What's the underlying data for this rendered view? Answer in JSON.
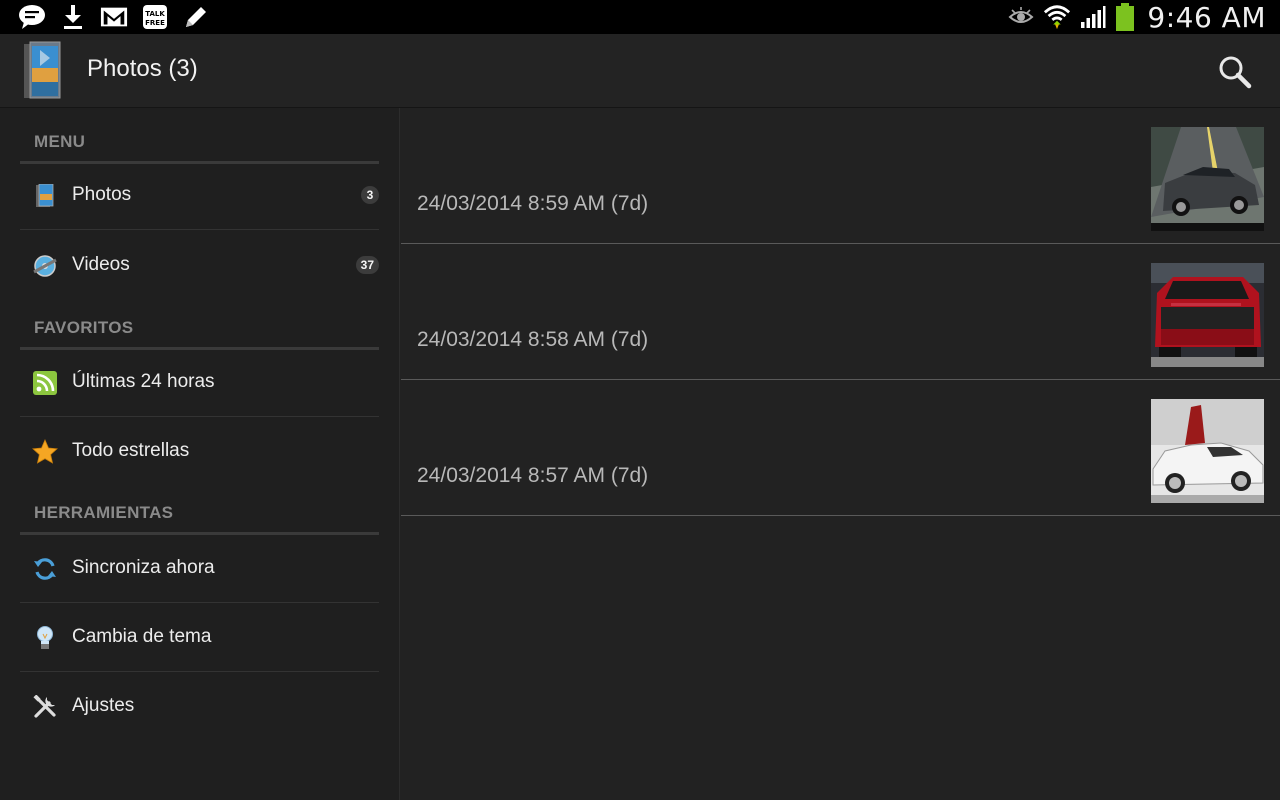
{
  "status_bar": {
    "icons": [
      "chat-icon",
      "download-icon",
      "gmail-icon",
      "talk-free-icon",
      "edit-icon"
    ],
    "right_icons": [
      "eye-icon",
      "wifi-icon",
      "signal-icon",
      "battery-icon"
    ],
    "talk_free_text": "TALK FREE",
    "time": "9:46 AM"
  },
  "action_bar": {
    "title": "Photos (3)",
    "search_icon": "search-icon"
  },
  "sidebar": {
    "sections": [
      {
        "header": "MENU",
        "items": [
          {
            "label": "Photos",
            "icon": "photos-icon",
            "badge": "3"
          },
          {
            "label": "Videos",
            "icon": "videos-icon",
            "badge": "37"
          }
        ]
      },
      {
        "header": "FAVORITOS",
        "items": [
          {
            "label": "Últimas 24 horas",
            "icon": "rss-icon"
          },
          {
            "label": "Todo estrellas",
            "icon": "star-icon"
          }
        ]
      },
      {
        "header": "HERRAMIENTAS",
        "items": [
          {
            "label": "Sincroniza ahora",
            "icon": "sync-icon"
          },
          {
            "label": "Cambia de tema",
            "icon": "lightbulb-icon"
          },
          {
            "label": "Ajustes",
            "icon": "tools-icon"
          }
        ]
      }
    ]
  },
  "photos": [
    {
      "date": "24/03/2014 8:59 AM (7d)",
      "thumbnail": "grey-car-on-road"
    },
    {
      "date": "24/03/2014 8:58 AM (7d)",
      "thumbnail": "red-car-rear"
    },
    {
      "date": "24/03/2014 8:57 AM (7d)",
      "thumbnail": "white-sports-car"
    }
  ],
  "colors": {
    "background": "#222222",
    "sidebar_background": "#1f1f1f",
    "section_header_text": "#8a8a8a",
    "battery_green": "#7cc21f",
    "rss_green": "#8cc63f",
    "star_orange": "#f5a623"
  }
}
